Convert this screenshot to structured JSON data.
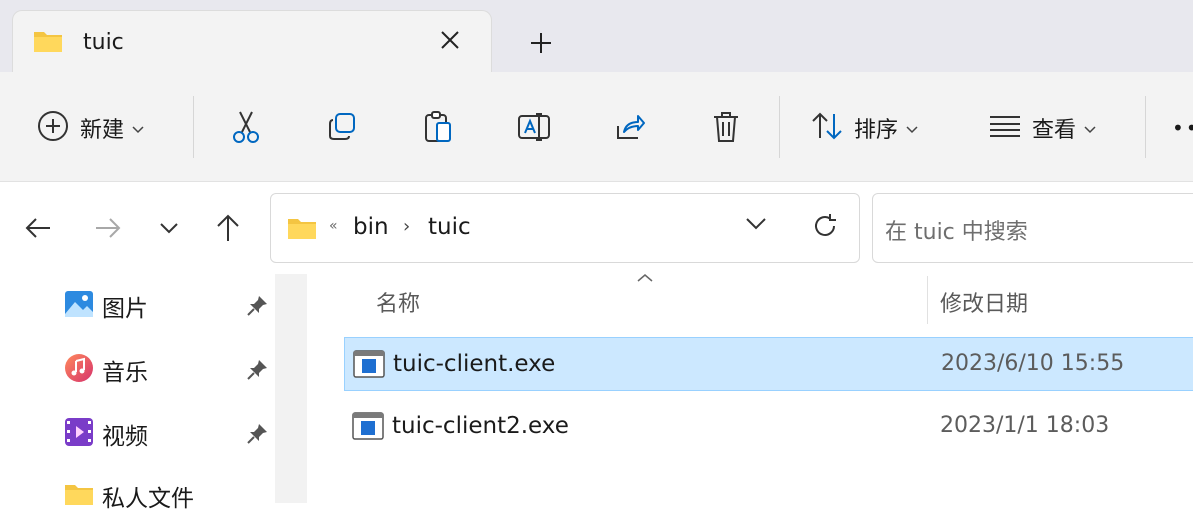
{
  "tab": {
    "title": "tuic",
    "close_icon": "close-icon",
    "new_tab_icon": "plus-icon"
  },
  "toolbar": {
    "new_label": "新建",
    "sort_label": "排序",
    "view_label": "查看",
    "more_label": "••",
    "icons": [
      "cut-icon",
      "copy-icon",
      "paste-icon",
      "rename-icon",
      "share-icon",
      "delete-icon"
    ]
  },
  "address": {
    "more": "«",
    "crumbs": [
      "bin",
      "tuic"
    ],
    "separator": "›"
  },
  "search": {
    "placeholder": "在 tuic 中搜索"
  },
  "nav_pane": {
    "items": [
      {
        "label": "图片",
        "icon": "pictures-icon",
        "pinned": true
      },
      {
        "label": "音乐",
        "icon": "music-icon",
        "pinned": true
      },
      {
        "label": "视频",
        "icon": "videos-icon",
        "pinned": true
      },
      {
        "label": "私人文件",
        "icon": "folder-icon",
        "pinned": false
      }
    ]
  },
  "columns": {
    "name": "名称",
    "date_modified": "修改日期"
  },
  "files": [
    {
      "name": "tuic-client.exe",
      "date": "2023/6/10 15:55",
      "selected": true
    },
    {
      "name": "tuic-client2.exe",
      "date": "2023/1/1 18:03",
      "selected": false
    }
  ],
  "colors": {
    "selection": "#cce8ff",
    "selection_border": "#99d1ff",
    "folder": "#f4c542",
    "accent": "#0067c0"
  }
}
